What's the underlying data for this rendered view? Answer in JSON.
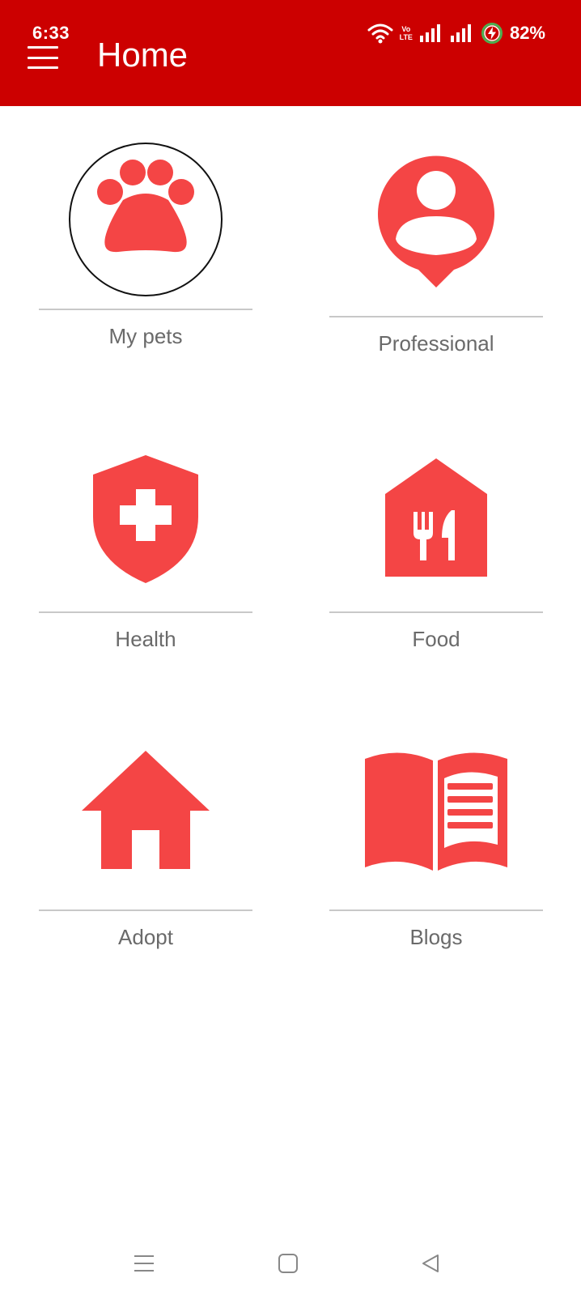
{
  "status_bar": {
    "time": "6:33",
    "battery": "82%",
    "volte_top": "Vo",
    "volte_bottom": "LTE",
    "icons": [
      "wifi-icon",
      "volte-icon",
      "signal-icon",
      "signal-icon",
      "battery-charging-icon"
    ]
  },
  "app_bar": {
    "title": "Home",
    "menu_icon": "hamburger-menu-icon"
  },
  "colors": {
    "app_bar": "#cc0000",
    "icon_red": "#f44545",
    "label_gray": "#6a6a6a",
    "divider": "#c8c8c8"
  },
  "grid": {
    "items": [
      {
        "label": "My pets",
        "icon": "paw-icon",
        "selected": true
      },
      {
        "label": "Professional",
        "icon": "professional-pin-icon",
        "selected": false
      },
      {
        "label": "Health",
        "icon": "health-shield-icon",
        "selected": false
      },
      {
        "label": "Food",
        "icon": "food-house-icon",
        "selected": false
      },
      {
        "label": "Adopt",
        "icon": "house-icon",
        "selected": false
      },
      {
        "label": "Blogs",
        "icon": "open-book-icon",
        "selected": false
      }
    ]
  },
  "nav_bar": {
    "icons": [
      "recents-icon",
      "home-nav-icon",
      "back-icon"
    ]
  }
}
